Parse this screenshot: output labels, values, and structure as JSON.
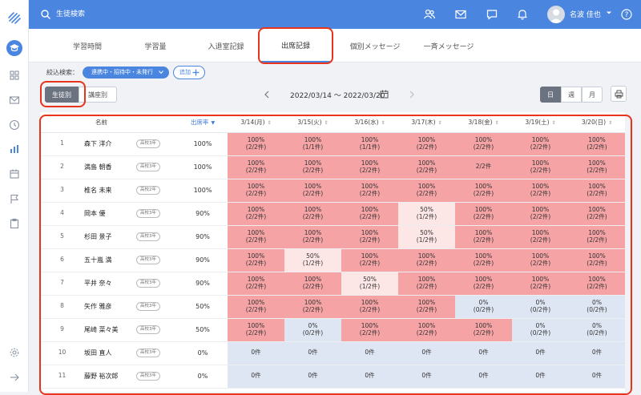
{
  "topbar": {
    "search_placeholder": "生徒検索",
    "user_name": "名波 佳也"
  },
  "tabs": [
    "学習時間",
    "学習量",
    "入退室記録",
    "出席記録",
    "個別メッセージ",
    "一斉メッセージ"
  ],
  "active_tab": 3,
  "filter": {
    "label": "絞込検索：",
    "chip": "連携中・招待中・未発行",
    "add_button": "追加"
  },
  "view_toggle": [
    "生徒別",
    "講座別"
  ],
  "date_range": "2022/03/14 〜 2022/03/20",
  "period_toggle": [
    "日",
    "週",
    "月"
  ],
  "table": {
    "headers": {
      "name": "名前",
      "rate": "出席率",
      "dates": [
        "3/14(月)",
        "3/15(火)",
        "3/16(水)",
        "3/17(木)",
        "3/18(金)",
        "3/19(土)",
        "3/20(日)"
      ]
    },
    "rows": [
      {
        "no": "1",
        "name": "森下 洋介",
        "grade": "高校3年",
        "rate": "100%",
        "cells": [
          [
            "100%",
            "(2/2件)"
          ],
          [
            "100%",
            "(1/1件)"
          ],
          [
            "100%",
            "(1/1件)"
          ],
          [
            "100%",
            "(2/2件)"
          ],
          [
            "100%",
            "(2/2件)"
          ],
          [
            "100%",
            "(2/2件)"
          ],
          [
            "100%",
            "(2/2件)"
          ]
        ]
      },
      {
        "no": "2",
        "name": "満島 朝香",
        "grade": "高校3年",
        "rate": "100%",
        "cells": [
          [
            "100%",
            "(2/2件)"
          ],
          [
            "100%",
            "(2/2件)"
          ],
          [
            "100%",
            "(2/2件)"
          ],
          [
            "100%",
            "(2/2件)"
          ],
          [
            "2/2件",
            ""
          ],
          [
            "100%",
            "(2/2件)"
          ],
          [
            "100%",
            "(2/2件)"
          ]
        ]
      },
      {
        "no": "3",
        "name": "椎名 未来",
        "grade": "高校2年",
        "rate": "100%",
        "cells": [
          [
            "100%",
            "(2/2件)"
          ],
          [
            "100%",
            "(2/2件)"
          ],
          [
            "100%",
            "(2/2件)"
          ],
          [
            "100%",
            "(2/2件)"
          ],
          [
            "100%",
            "(2/2件)"
          ],
          [
            "100%",
            "(2/2件)"
          ],
          [
            "100%",
            "(2/2件)"
          ]
        ]
      },
      {
        "no": "4",
        "name": "岡本 優",
        "grade": "高校3年",
        "rate": "90%",
        "cells": [
          [
            "100%",
            "(2/2件)"
          ],
          [
            "100%",
            "(2/2件)"
          ],
          [
            "100%",
            "(2/2件)"
          ],
          [
            "50%",
            "(1/2件)"
          ],
          [
            "100%",
            "(2/2件)"
          ],
          [
            "100%",
            "(2/2件)"
          ],
          [
            "100%",
            "(2/2件)"
          ]
        ]
      },
      {
        "no": "5",
        "name": "杉田 景子",
        "grade": "高校3年",
        "rate": "90%",
        "cells": [
          [
            "100%",
            "(2/2件)"
          ],
          [
            "100%",
            "(2/2件)"
          ],
          [
            "100%",
            "(2/2件)"
          ],
          [
            "50%",
            "(1/2件)"
          ],
          [
            "100%",
            "(2/2件)"
          ],
          [
            "100%",
            "(2/2件)"
          ],
          [
            "100%",
            "(2/2件)"
          ]
        ]
      },
      {
        "no": "6",
        "name": "五十嵐 満",
        "grade": "高校3年",
        "rate": "90%",
        "cells": [
          [
            "100%",
            "(2/2件)"
          ],
          [
            "50%",
            "(1/2件)"
          ],
          [
            "100%",
            "(2/2件)"
          ],
          [
            "100%",
            "(2/2件)"
          ],
          [
            "100%",
            "(2/2件)"
          ],
          [
            "100%",
            "(2/2件)"
          ],
          [
            "100%",
            "(2/2件)"
          ]
        ]
      },
      {
        "no": "7",
        "name": "平井 奈々",
        "grade": "高校3年",
        "rate": "90%",
        "cells": [
          [
            "100%",
            "(2/2件)"
          ],
          [
            "100%",
            "(2/2件)"
          ],
          [
            "50%",
            "(1/2件)"
          ],
          [
            "100%",
            "(2/2件)"
          ],
          [
            "100%",
            "(2/2件)"
          ],
          [
            "100%",
            "(2/2件)"
          ],
          [
            "100%",
            "(2/2件)"
          ]
        ]
      },
      {
        "no": "8",
        "name": "矢作 雅彦",
        "grade": "高校3年",
        "rate": "50%",
        "cells": [
          [
            "100%",
            "(2/2件)"
          ],
          [
            "100%",
            "(2/2件)"
          ],
          [
            "100%",
            "(2/2件)"
          ],
          [
            "100%",
            "(2/2件)"
          ],
          [
            "0%",
            "(0/2件)"
          ],
          [
            "0%",
            "(0/2件)"
          ],
          [
            "0%",
            "(0/2件)"
          ]
        ]
      },
      {
        "no": "9",
        "name": "尾崎 菜々美",
        "grade": "高校3年",
        "rate": "50%",
        "cells": [
          [
            "100%",
            "(2/2件)"
          ],
          [
            "0%",
            "(0/2件)"
          ],
          [
            "100%",
            "(2/2件)"
          ],
          [
            "100%",
            "(2/2件)"
          ],
          [
            "100%",
            "(2/2件)"
          ],
          [
            "0%",
            "(0/2件)"
          ],
          [
            "0%",
            "(0/2件)"
          ]
        ]
      },
      {
        "no": "10",
        "name": "坂田 直人",
        "grade": "高校3年",
        "rate": "0%",
        "cells": [
          [
            "0件",
            ""
          ],
          [
            "0件",
            ""
          ],
          [
            "0件",
            ""
          ],
          [
            "0件",
            ""
          ],
          [
            "0件",
            ""
          ],
          [
            "0件",
            ""
          ],
          [
            "0件",
            ""
          ]
        ]
      },
      {
        "no": "11",
        "name": "藤野 裕次郎",
        "grade": "高校3年",
        "rate": "0%",
        "cells": [
          [
            "0件",
            ""
          ],
          [
            "0件",
            ""
          ],
          [
            "0件",
            ""
          ],
          [
            "0件",
            ""
          ],
          [
            "0件",
            ""
          ],
          [
            "0件",
            ""
          ],
          [
            "0件",
            ""
          ]
        ]
      }
    ]
  },
  "colors": {
    "primary": "#4a86e0",
    "full": "#f5a3a5",
    "half": "#fde6e6",
    "zero": "#dfe6f3",
    "highlight": "#e8341c"
  }
}
